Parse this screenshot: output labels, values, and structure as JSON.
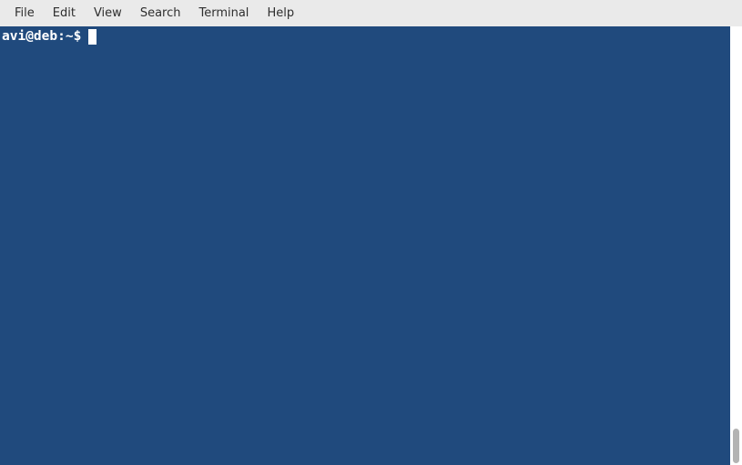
{
  "menubar": {
    "items": [
      {
        "label": "File"
      },
      {
        "label": "Edit"
      },
      {
        "label": "View"
      },
      {
        "label": "Search"
      },
      {
        "label": "Terminal"
      },
      {
        "label": "Help"
      }
    ]
  },
  "terminal": {
    "prompt": "avi@deb:~$",
    "input": ""
  }
}
